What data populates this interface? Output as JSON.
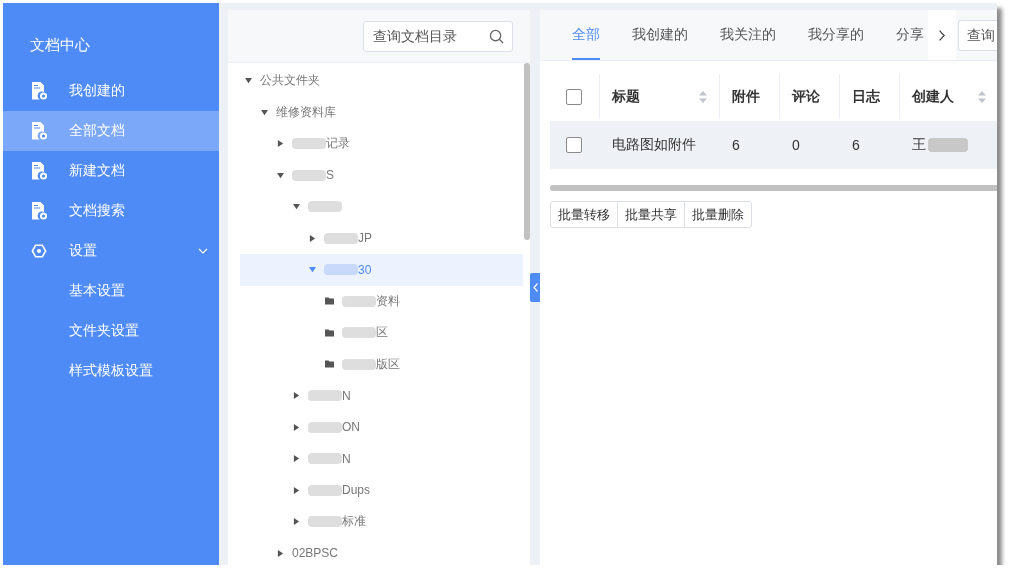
{
  "sidebar": {
    "title": "文档中心",
    "items": [
      {
        "kind": "page",
        "label": "我创建的",
        "selected": false
      },
      {
        "kind": "page",
        "label": "全部文档",
        "selected": true
      },
      {
        "kind": "page",
        "label": "新建文档",
        "selected": false
      },
      {
        "kind": "page",
        "label": "文档搜索",
        "selected": false
      },
      {
        "kind": "group",
        "label": "设置",
        "selected": false,
        "expanded": true,
        "children": [
          {
            "label": "基本设置",
            "selected": false
          },
          {
            "label": "文件夹设置",
            "selected": false
          },
          {
            "label": "样式模板设置",
            "selected": false
          }
        ]
      }
    ]
  },
  "tree_panel": {
    "search": {
      "placeholder": "查询文档目录"
    },
    "tree": [
      {
        "kind": "branch",
        "label": "公共文件夹",
        "redacted": false,
        "expanded": true,
        "selected": false,
        "children": [
          {
            "kind": "branch",
            "label": "维修资料库",
            "redacted": false,
            "expanded": true,
            "selected": false,
            "children": [
              {
                "kind": "branch",
                "label": "记录",
                "redacted": true,
                "expanded": false,
                "selected": false
              },
              {
                "kind": "branch",
                "label": "S",
                "redacted": true,
                "expanded": true,
                "selected": false,
                "children": [
                  {
                    "kind": "branch",
                    "redacted": true,
                    "expanded": true,
                    "selected": false,
                    "children": [
                      {
                        "kind": "branch",
                        "label": "JP",
                        "redacted": true,
                        "expanded": false,
                        "selected": false
                      },
                      {
                        "kind": "branch",
                        "label": "30",
                        "redacted": true,
                        "expanded": true,
                        "selected": true,
                        "children": [
                          {
                            "kind": "folder",
                            "label": "资料",
                            "redacted": true,
                            "selected": false
                          },
                          {
                            "kind": "folder",
                            "label": "区",
                            "redacted": true,
                            "selected": false
                          },
                          {
                            "kind": "folder",
                            "label": "版区",
                            "redacted": true,
                            "selected": false
                          }
                        ]
                      }
                    ]
                  },
                  {
                    "kind": "branch",
                    "label": "N",
                    "redacted": true,
                    "expanded": false,
                    "selected": false
                  },
                  {
                    "kind": "branch",
                    "label": "ON",
                    "redacted": true,
                    "expanded": false,
                    "selected": false
                  },
                  {
                    "kind": "branch",
                    "label": "N",
                    "redacted": true,
                    "expanded": false,
                    "selected": false
                  },
                  {
                    "kind": "branch",
                    "label": "Dups",
                    "redacted": true,
                    "expanded": false,
                    "selected": false
                  },
                  {
                    "kind": "branch",
                    "label": "标准",
                    "redacted": true,
                    "expanded": false,
                    "selected": false
                  }
                ]
              },
              {
                "kind": "branch",
                "label": "02BPSC",
                "redacted": false,
                "expanded": false,
                "selected": false
              }
            ]
          }
        ]
      }
    ]
  },
  "main": {
    "tabs": [
      {
        "label": "全部",
        "selected": true
      },
      {
        "label": "我创建的",
        "selected": false
      },
      {
        "label": "我关注的",
        "selected": false
      },
      {
        "label": "我分享的",
        "selected": false
      },
      {
        "label": "分享",
        "selected": false
      }
    ],
    "search": {
      "placeholder": "查询"
    },
    "table": {
      "header_checked": false,
      "columns": [
        {
          "label": "标题",
          "sortable": true
        },
        {
          "label": "附件",
          "sortable": false
        },
        {
          "label": "评论",
          "sortable": false
        },
        {
          "label": "日志",
          "sortable": false
        },
        {
          "label": "创建人",
          "sortable": true
        }
      ],
      "rows": [
        {
          "checked": false,
          "highlighted": true,
          "cells": [
            {
              "text": "电路图如附件",
              "redacted": false
            },
            {
              "text": "6",
              "redacted": false
            },
            {
              "text": "0",
              "redacted": false
            },
            {
              "text": "6",
              "redacted": false
            },
            {
              "text": "王",
              "redacted": true
            }
          ]
        }
      ]
    },
    "batch_buttons": [
      "批量转移",
      "批量共享",
      "批量删除"
    ]
  }
}
